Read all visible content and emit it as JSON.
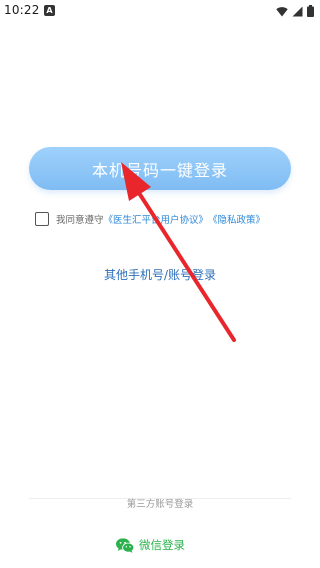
{
  "status_bar": {
    "time": "10:22",
    "app_indicator": "A",
    "icons": [
      "wifi-icon",
      "signal-icon",
      "battery-icon"
    ]
  },
  "login": {
    "one_click_label": "本机号码一键登录",
    "agreement_prefix": "我同意遵守",
    "user_agreement_link": "《医生汇平台用户协议》",
    "privacy_policy_link": "《隐私政策》",
    "other_login_label": "其他手机号/账号登录"
  },
  "third_party": {
    "title": "第三方账号登录",
    "wechat_label": "微信登录"
  },
  "colors": {
    "button_gradient_top": "#9fd1fb",
    "button_gradient_bottom": "#7fbcf3",
    "link_blue": "#2d88d8",
    "wechat_green": "#2bb24c",
    "annotation_arrow": "#e8262c"
  }
}
